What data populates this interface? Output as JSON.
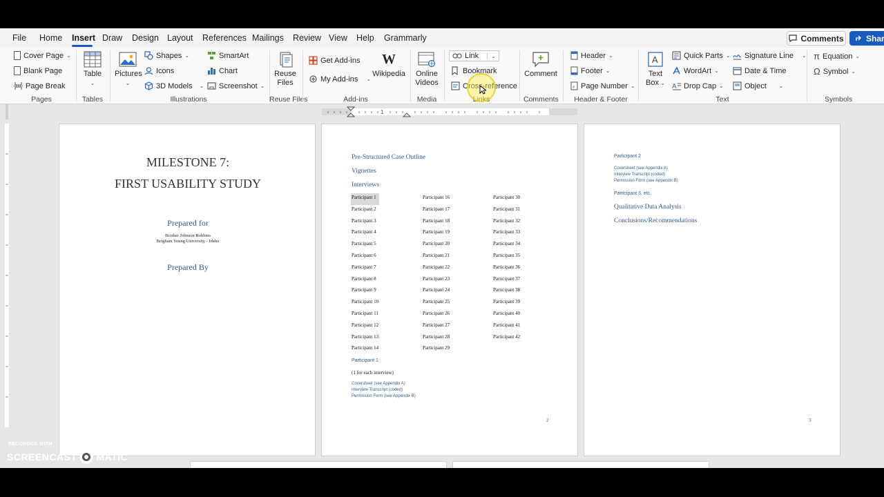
{
  "menu": {
    "tabs": [
      "File",
      "Home",
      "Insert",
      "Draw",
      "Design",
      "Layout",
      "References",
      "Mailings",
      "Review",
      "View",
      "Help",
      "Grammarly"
    ],
    "active": "Insert",
    "comments_label": "Comments",
    "share_label": "Share"
  },
  "ribbon": {
    "pages": {
      "cover_page": "Cover Page",
      "blank_page": "Blank Page",
      "page_break": "Page Break",
      "group": "Pages"
    },
    "tables": {
      "table": "Table",
      "group": "Tables"
    },
    "illustrations": {
      "pictures": "Pictures",
      "shapes": "Shapes",
      "icons": "Icons",
      "models3d": "3D Models",
      "smartart": "SmartArt",
      "chart": "Chart",
      "screenshot": "Screenshot",
      "group": "Illustrations"
    },
    "reuse": {
      "reuse_files_1": "Reuse",
      "reuse_files_2": "Files",
      "group": "Reuse Files"
    },
    "addins": {
      "get_addins": "Get Add-ins",
      "my_addins": "My Add-ins",
      "wikipedia": "Wikipedia",
      "group": "Add-ins"
    },
    "media": {
      "online_1": "Online",
      "online_2": "Videos",
      "group": "Media"
    },
    "links": {
      "link": "Link",
      "bookmark": "Bookmark",
      "cross_reference": "Cross-reference",
      "group": "Links"
    },
    "comments": {
      "comment": "Comment",
      "group": "Comments"
    },
    "header_footer": {
      "header": "Header",
      "footer": "Footer",
      "page_number": "Page Number",
      "group": "Header & Footer"
    },
    "text": {
      "text_box_1": "Text",
      "text_box_2": "Box",
      "quick_parts": "Quick Parts",
      "wordart": "WordArt",
      "drop_cap": "Drop Cap",
      "signature_line": "Signature Line",
      "date_time": "Date & Time",
      "object": "Object",
      "group": "Text"
    },
    "symbols": {
      "equation": "Equation",
      "symbol": "Symbol",
      "group": "Symbols"
    }
  },
  "page1": {
    "title_line1": "MILESTONE 7:",
    "title_line2": "FIRST USABILITY STUDY",
    "prepared_for": "Prepared for",
    "recipient_1": "Brother Johnson Robbins",
    "recipient_2": "Brigham Young University - Idaho",
    "prepared_by": "Prepared By"
  },
  "page2": {
    "heading1": "Pre-Structured Case Outline",
    "heading2": "Vignettes",
    "heading3": "Interviews",
    "col1": [
      "Participant 1",
      "Participant 2",
      "Participant 3",
      "Participant 4",
      "Participant 5",
      "Participant 6",
      "Participant 7",
      "Participant 8",
      "Participant 9",
      "Participant 10",
      "Participant 11",
      "Participant 12",
      "Participant 13",
      "Participant 14"
    ],
    "col2": [
      "Participant 16",
      "Participant 17",
      "Participant 18",
      "Participant 19",
      "Participant 20",
      "Participant 21",
      "Participant 22",
      "Participant 23",
      "Participant 24",
      "Participant 25",
      "Participant 26",
      "Participant 27",
      "Participant 28",
      "Participant 29"
    ],
    "col3": [
      "Participant 30",
      "Participant 31",
      "Participant 32",
      "Participant 33",
      "Participant 34",
      "Participant 35",
      "Participant 36",
      "Participant 37",
      "Participant 38",
      "Participant 39",
      "Participant 40",
      "Participant 41",
      "Participant 42"
    ],
    "sub_heading": "Participant 1",
    "note": "(1 for each interview)",
    "items": [
      "Coversheet (see Appendix A)",
      "Interview Transcript (coded)",
      "Permission Form (see Appendix B)"
    ],
    "page_number": "2"
  },
  "page3": {
    "sub_heading": "Participant 2",
    "items": [
      "Coversheet (see Appendix A)",
      "Interview Transcript (coded)",
      "Permission Form (see Appendix B)"
    ],
    "etc": "Participant 3, etc.",
    "heading1": "Qualitative Data Analysis",
    "heading2": "Conclusions/Recommendations",
    "page_number": "3"
  },
  "watermark": {
    "line1": "RECORDED WITH",
    "line2a": "SCREENCAST",
    "line2b": "MATIC"
  },
  "colors": {
    "accent": "#185abd",
    "heading_blue": "#2e5c8a"
  }
}
